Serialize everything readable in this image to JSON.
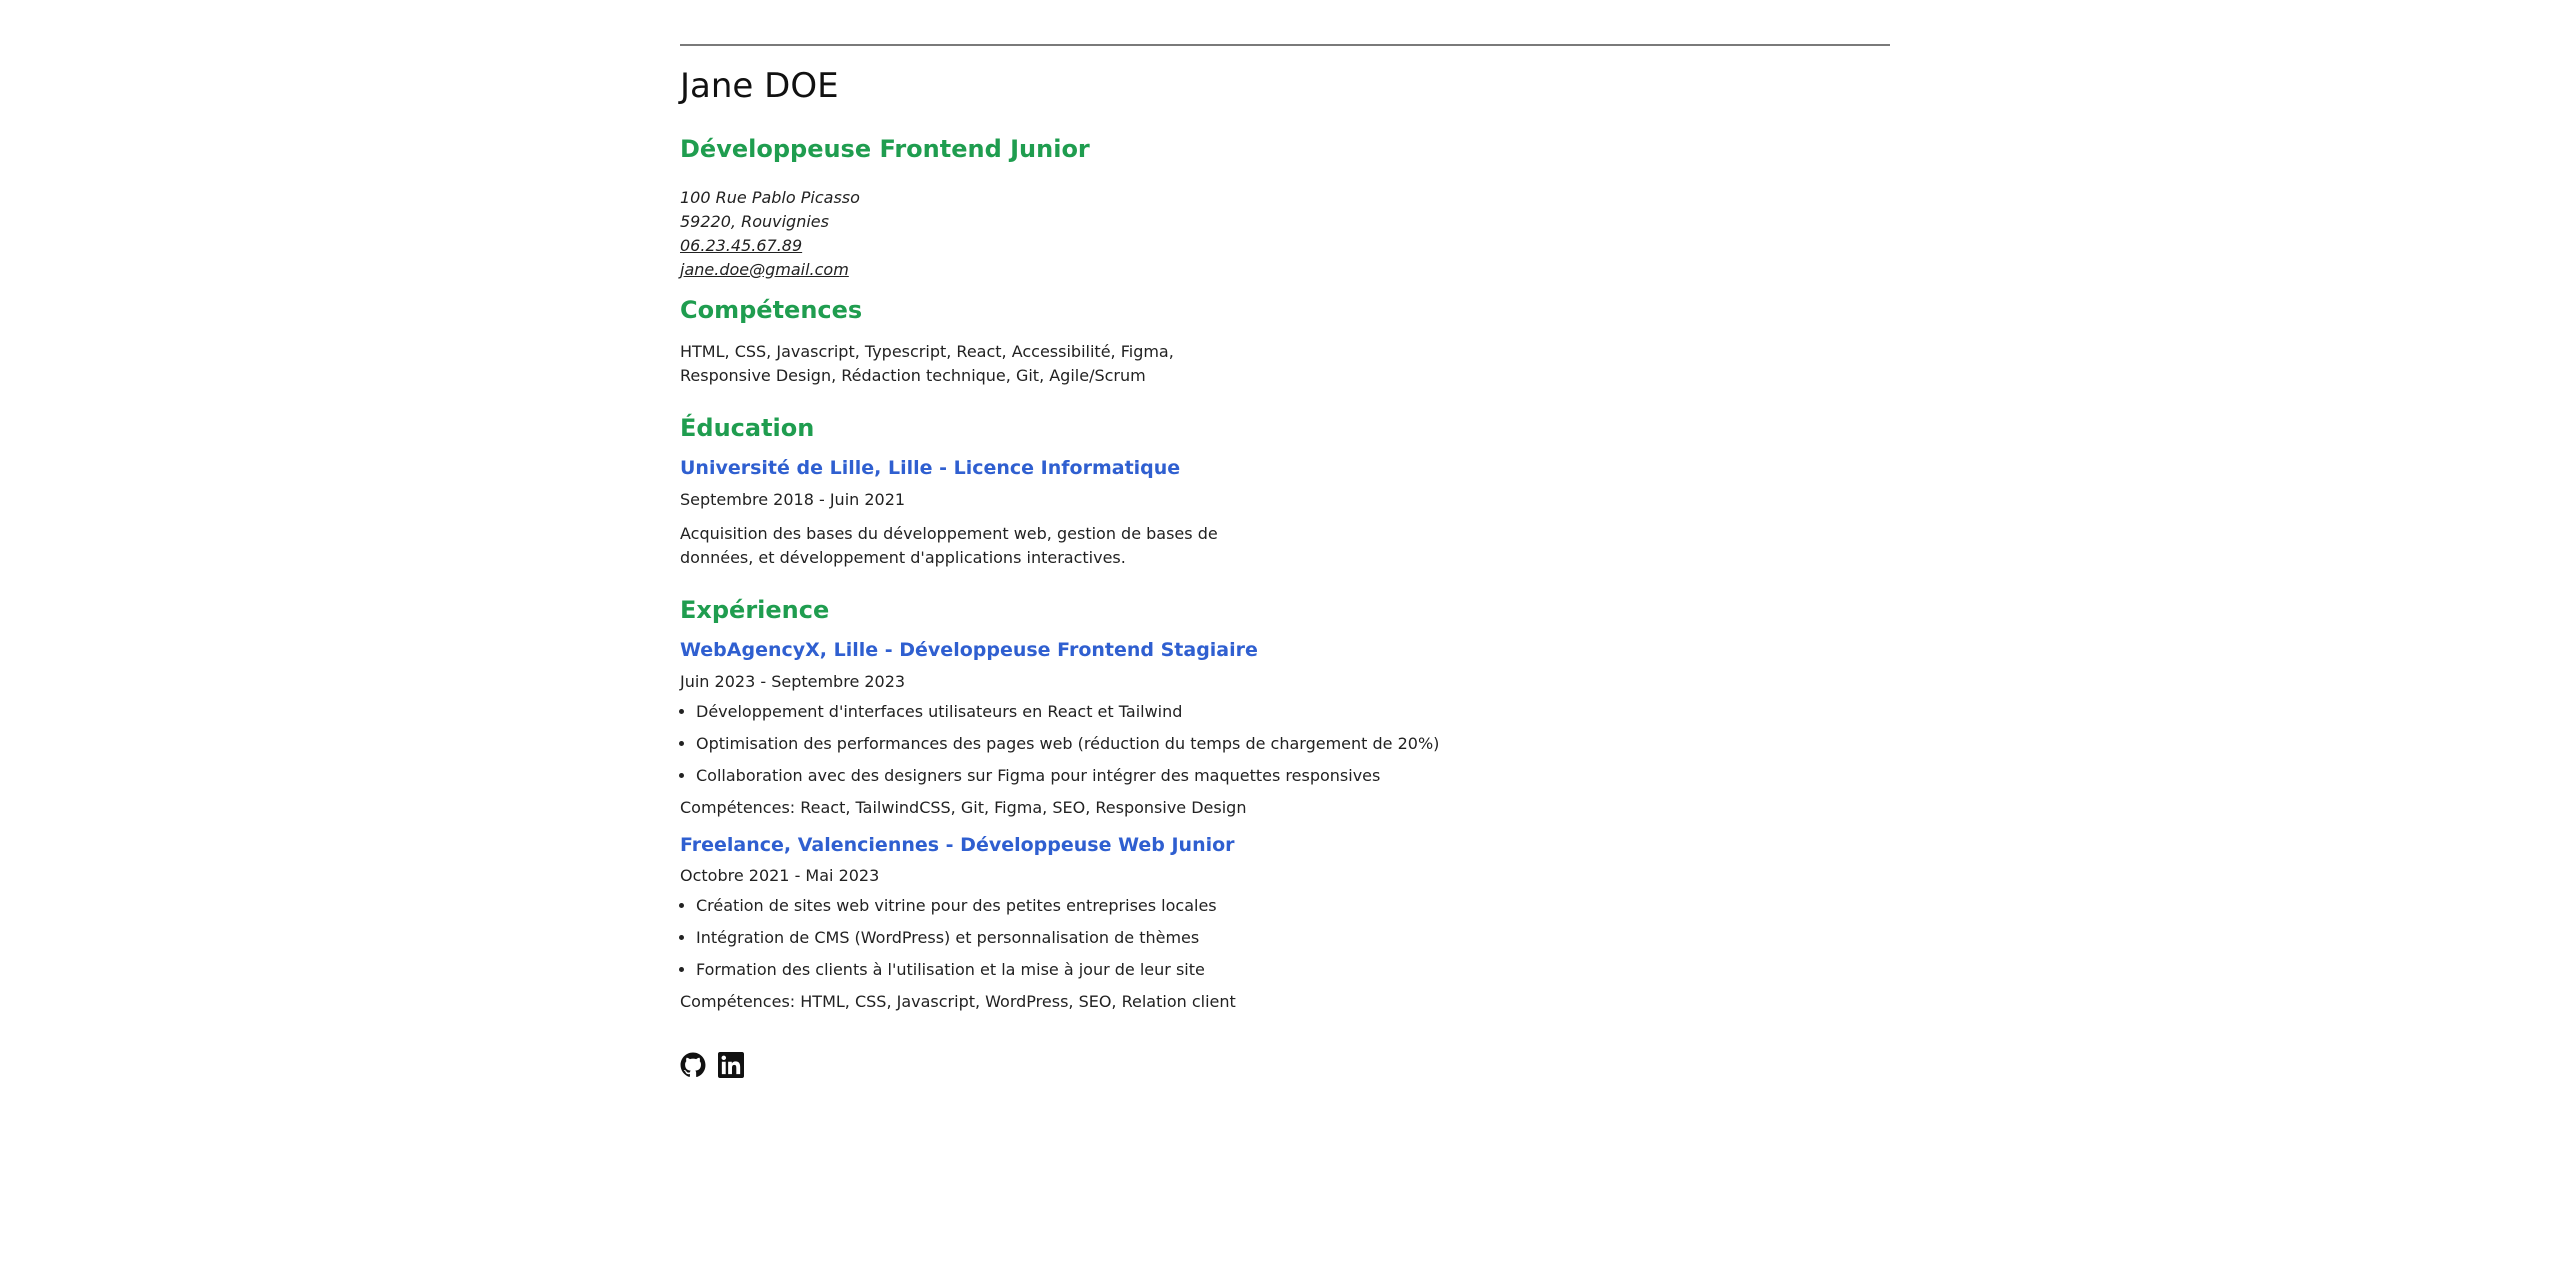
{
  "header": {
    "name": "Jane DOE",
    "role": "Développeuse Frontend Junior"
  },
  "contact": {
    "street": "100 Rue Pablo Picasso",
    "city": "59220, Rouvignies",
    "phone": "06.23.45.67.89",
    "email": "jane.doe@gmail.com"
  },
  "skills": {
    "title": "Compétences",
    "text": "HTML, CSS, Javascript, Typescript, React, Accessibilité, Figma, Responsive Design, Rédaction technique, Git, Agile/Scrum"
  },
  "education": {
    "title": "Éducation",
    "entry_title": "Université de Lille, Lille - Licence Informatique",
    "dates": "Septembre 2018 - Juin 2021",
    "description": "Acquisition des bases du développement web, gestion de bases de données, et développement d'applications interactives."
  },
  "experience": {
    "title": "Expérience",
    "jobs": [
      {
        "title": "WebAgencyX, Lille - Développeuse Frontend Stagiaire",
        "dates": "Juin 2023 - Septembre 2023",
        "bullets": [
          "Développement d'interfaces utilisateurs en React et Tailwind",
          "Optimisation des performances des pages web (réduction du temps de chargement de 20%)",
          "Collaboration avec des designers sur Figma pour intégrer des maquettes responsives"
        ],
        "skills": "Compétences: React, TailwindCSS, Git, Figma, SEO, Responsive Design"
      },
      {
        "title": "Freelance, Valenciennes - Développeuse Web Junior",
        "dates": "Octobre 2021 - Mai 2023",
        "bullets": [
          "Création de sites web vitrine pour des petites entreprises locales",
          "Intégration de CMS (WordPress) et personnalisation de thèmes",
          "Formation des clients à l'utilisation et la mise à jour de leur site"
        ],
        "skills": "Compétences: HTML, CSS, Javascript, WordPress, SEO, Relation client"
      }
    ]
  },
  "socials": {
    "icons": [
      "github-icon",
      "linkedin-icon"
    ]
  }
}
